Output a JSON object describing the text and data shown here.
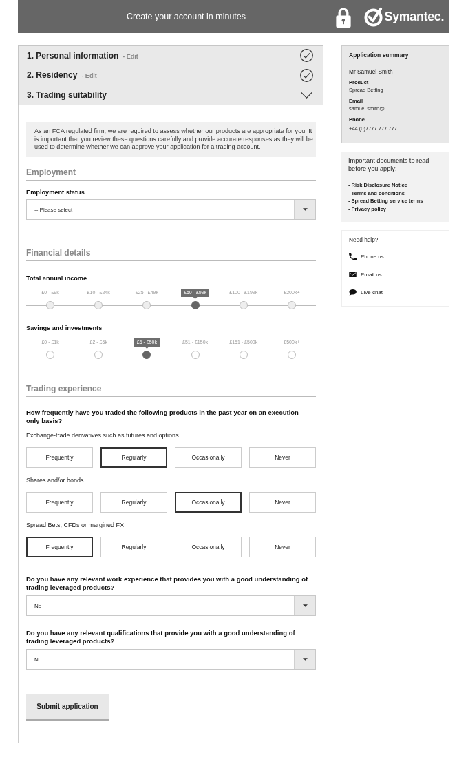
{
  "header": {
    "title": "Create your account in minutes",
    "brand": "Symantec."
  },
  "steps": [
    {
      "title": "1. Personal information",
      "edit": "- Edit",
      "completed": true,
      "expanded": false
    },
    {
      "title": "2. Residency",
      "edit": "- Edit",
      "completed": true,
      "expanded": false
    },
    {
      "title": "3. Trading suitability",
      "completed": false,
      "expanded": true
    }
  ],
  "form": {
    "intro": "As an FCA regulated firm, we are required to assess whether our products are appropriate for you. It is important that you review these questions carefully and provide accurate responses as they will be used to determine whether we can approve your application for a trading account.",
    "employment": {
      "heading": "Employment",
      "field": {
        "label": "Employment status",
        "placeholder": "-- Please select"
      }
    },
    "financial": {
      "heading": "Financial details",
      "scales": [
        {
          "label": "Total annual income",
          "options": [
            {
              "label": "£0 - £9k",
              "selected": false
            },
            {
              "label": "£10 - £24k",
              "selected": false
            },
            {
              "label": "£25 - £49k",
              "selected": false
            },
            {
              "label": "£50 - £99k",
              "selected": true
            },
            {
              "label": "£100 - £199k",
              "selected": false
            },
            {
              "label": "£200k+",
              "selected": false
            }
          ]
        },
        {
          "label": "Savings and investments",
          "options": [
            {
              "label": "£0 - £1k",
              "selected": false
            },
            {
              "label": "£2 - £5k",
              "selected": false
            },
            {
              "label": "£6 - £50k",
              "selected": true
            },
            {
              "label": "£51 - £150k",
              "selected": false
            },
            {
              "label": "£151 - £500k",
              "selected": false
            },
            {
              "label": "£500k+",
              "selected": false
            }
          ]
        }
      ]
    },
    "trading": {
      "heading": "Trading experience",
      "question": "How frequently have you traded the following products in the past year on an execution only basis?",
      "products": [
        {
          "label": "Exchange-trade derivatives such as futures and options",
          "options": [
            {
              "label": "Frequently",
              "selected": false
            },
            {
              "label": "Regularly",
              "selected": true
            },
            {
              "label": "Occasionally",
              "selected": false
            },
            {
              "label": "Never",
              "selected": false
            }
          ]
        },
        {
          "label": "Shares and/or bonds",
          "options": [
            {
              "label": "Frequently",
              "selected": false
            },
            {
              "label": "Regularly",
              "selected": false
            },
            {
              "label": "Occasionally",
              "selected": true
            },
            {
              "label": "Never",
              "selected": false
            }
          ]
        },
        {
          "label": "Spread Bets, CFDs or margined FX",
          "options": [
            {
              "label": "Frequently",
              "selected": true
            },
            {
              "label": "Regularly",
              "selected": false
            },
            {
              "label": "Occasionally",
              "selected": false
            },
            {
              "label": "Never",
              "selected": false
            }
          ]
        }
      ],
      "questions": [
        {
          "label": "Do you have any relevant work experience that provides you with a good understanding of trading leveraged products?",
          "value": "No"
        },
        {
          "label": "Do you have any relevant qualifications that provide you with a good understanding of trading leveraged products?",
          "value": "No"
        }
      ]
    },
    "submit": "Submit application"
  },
  "sidebar": {
    "summary": {
      "title": "Application summary",
      "name": "Mr Samuel Smith",
      "fields": [
        {
          "label": "Product",
          "value": "Spread Betting"
        },
        {
          "label": "Email",
          "value": "samuel.smith@"
        },
        {
          "label": "Phone",
          "value": "+44 (0)7777 777 777"
        }
      ]
    },
    "documents": {
      "intro": "Important documents to read before you apply:",
      "links": [
        "- Risk Disclosure Notice",
        "- Terms and conditions",
        "- Spread Betting service terms",
        "- Privacy policy"
      ]
    },
    "help": {
      "title": "Need help?",
      "items": [
        {
          "kind": "phone",
          "label": "Phone us"
        },
        {
          "kind": "email",
          "label": "Email us"
        },
        {
          "kind": "chat",
          "label": "Live chat"
        }
      ]
    }
  }
}
